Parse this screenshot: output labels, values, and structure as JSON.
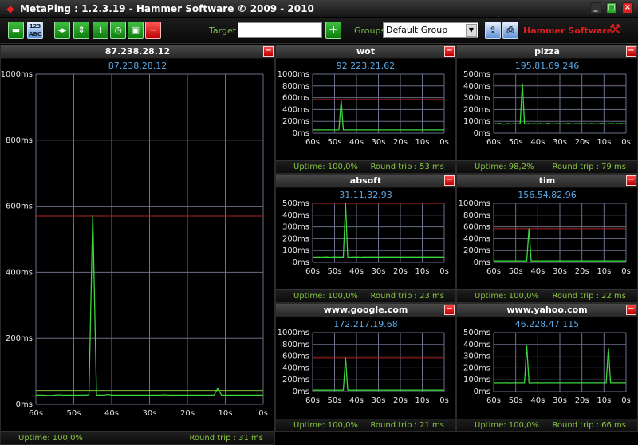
{
  "window": {
    "title": "MetaPing : 1.2.3.19 - Hammer Software © 2009 - 2010",
    "controls": [
      "_",
      "□",
      "×"
    ]
  },
  "toolbar": {
    "target_label": "Target",
    "target_value": "",
    "add_label": "+",
    "groups_label": "Groups",
    "group_value": "Default Group",
    "brand": "Hammer Software"
  },
  "colors": {
    "ping_line": "#3dd63d",
    "threshold_line": "#b32222",
    "grid": "#6a6f8a",
    "ip_text": "#5aa8e6",
    "footer_text": "#86c43e"
  },
  "panels": [
    {
      "name": "87.238.28.12",
      "ip": "87.238.28.12",
      "uptime": "Uptime: 100,0%",
      "round_trip": "Round trip : 31 ms",
      "chart_data": {
        "type": "line",
        "y_ticks": [
          "0ms",
          "200ms",
          "400ms",
          "600ms",
          "800ms",
          "1000ms"
        ],
        "ylim": [
          0,
          1000
        ],
        "x_ticks": [
          "60s",
          "50s",
          "40s",
          "30s",
          "20s",
          "10s",
          "0s"
        ],
        "threshold": 570,
        "secondary_threshold": 42,
        "values": [
          28,
          28,
          28,
          27,
          27,
          28,
          29,
          28,
          28,
          28,
          28,
          28,
          28,
          28,
          29,
          575,
          28,
          28,
          28,
          30,
          28,
          28,
          28,
          28,
          28,
          28,
          28,
          28,
          28,
          28,
          28,
          28,
          28,
          28,
          29,
          28,
          28,
          28,
          28,
          28,
          28,
          28,
          28,
          28,
          28,
          28,
          28,
          28,
          48,
          28,
          28,
          28,
          28,
          28,
          28,
          28,
          28,
          28,
          28,
          28,
          28
        ]
      }
    },
    {
      "name": "wot",
      "ip": "92.223.21.62",
      "uptime": "Uptime: 100,0%",
      "round_trip": "Round trip : 53 ms",
      "chart_data": {
        "type": "line",
        "y_ticks": [
          "0ms",
          "200ms",
          "400ms",
          "600ms",
          "800ms",
          "1000ms"
        ],
        "ylim": [
          0,
          1000
        ],
        "x_ticks": [
          "60s",
          "50s",
          "40s",
          "30s",
          "20s",
          "10s",
          "0s"
        ],
        "threshold": 570,
        "values": [
          55,
          55,
          55,
          54,
          55,
          55,
          55,
          55,
          55,
          55,
          55,
          55,
          55,
          560,
          55,
          55,
          55,
          55,
          55,
          55,
          55,
          55,
          55,
          55,
          55,
          55,
          55,
          55,
          55,
          55,
          55,
          55,
          55,
          55,
          55,
          55,
          55,
          55,
          55,
          55,
          55,
          55,
          55,
          55,
          55,
          55,
          55,
          55,
          55,
          55,
          55,
          55,
          55,
          55,
          55,
          55,
          55,
          55,
          55,
          55,
          55
        ]
      }
    },
    {
      "name": "pizza",
      "ip": "195.81.69.246",
      "uptime": "Uptime: 98,2%",
      "round_trip": "Round trip : 79 ms",
      "chart_data": {
        "type": "line",
        "y_ticks": [
          "0ms",
          "100ms",
          "200ms",
          "300ms",
          "400ms",
          "500ms"
        ],
        "ylim": [
          0,
          500
        ],
        "x_ticks": [
          "60s",
          "50s",
          "40s",
          "30s",
          "20s",
          "10s",
          "0s"
        ],
        "threshold": 410,
        "values": [
          78,
          80,
          79,
          82,
          78,
          77,
          80,
          79,
          78,
          80,
          78,
          79,
          81,
          420,
          78,
          79,
          82,
          78,
          80,
          79,
          78,
          81,
          79,
          78,
          80,
          82,
          79,
          78,
          80,
          79,
          81,
          78,
          79,
          80,
          82,
          79,
          78,
          80,
          79,
          81,
          78,
          80,
          79,
          78,
          81,
          80,
          79,
          78,
          80,
          82,
          79,
          78,
          80,
          79,
          81,
          78,
          80,
          79,
          82,
          78,
          80
        ]
      }
    },
    {
      "name": "absoft",
      "ip": "31.11.32.93",
      "uptime": "Uptime: 100,0%",
      "round_trip": "Round trip : 23 ms",
      "chart_data": {
        "type": "line",
        "y_ticks": [
          "0ms",
          "100ms",
          "200ms",
          "300ms",
          "400ms",
          "500ms"
        ],
        "ylim": [
          0,
          500
        ],
        "x_ticks": [
          "60s",
          "50s",
          "40s",
          "30s",
          "20s",
          "10s",
          "0s"
        ],
        "threshold": 500,
        "values": [
          45,
          44,
          45,
          45,
          44,
          45,
          46,
          45,
          44,
          45,
          45,
          45,
          45,
          45,
          45,
          500,
          45,
          44,
          45,
          45,
          46,
          45,
          44,
          45,
          45,
          45,
          45,
          45,
          45,
          45,
          45,
          45,
          45,
          45,
          45,
          45,
          45,
          45,
          45,
          45,
          45,
          45,
          45,
          45,
          45,
          45,
          45,
          45,
          45,
          45,
          45,
          45,
          45,
          45,
          45,
          45,
          45,
          45,
          45,
          45,
          45
        ]
      }
    },
    {
      "name": "tim",
      "ip": "156.54.82.96",
      "uptime": "Uptime: 100,0%",
      "round_trip": "Round trip : 22 ms",
      "chart_data": {
        "type": "line",
        "y_ticks": [
          "0ms",
          "200ms",
          "400ms",
          "600ms",
          "800ms",
          "1000ms"
        ],
        "ylim": [
          0,
          1000
        ],
        "x_ticks": [
          "60s",
          "50s",
          "40s",
          "30s",
          "20s",
          "10s",
          "0s"
        ],
        "threshold": 570,
        "values": [
          25,
          25,
          25,
          25,
          25,
          25,
          25,
          25,
          25,
          25,
          25,
          25,
          25,
          25,
          25,
          25,
          575,
          25,
          25,
          25,
          25,
          25,
          25,
          25,
          25,
          25,
          25,
          25,
          25,
          25,
          25,
          25,
          25,
          25,
          25,
          25,
          25,
          25,
          25,
          25,
          25,
          25,
          25,
          25,
          25,
          25,
          25,
          25,
          25,
          25,
          25,
          25,
          25,
          25,
          25,
          25,
          25,
          25,
          25,
          25,
          25
        ]
      }
    },
    {
      "name": "www.google.com",
      "ip": "172.217.19.68",
      "uptime": "Uptime: 100,0%",
      "round_trip": "Round trip : 21 ms",
      "chart_data": {
        "type": "line",
        "y_ticks": [
          "0ms",
          "200ms",
          "400ms",
          "600ms",
          "800ms",
          "1000ms"
        ],
        "ylim": [
          0,
          1000
        ],
        "x_ticks": [
          "60s",
          "50s",
          "40s",
          "30s",
          "20s",
          "10s",
          "0s"
        ],
        "threshold": 570,
        "values": [
          25,
          25,
          25,
          25,
          25,
          25,
          25,
          25,
          25,
          25,
          25,
          25,
          25,
          25,
          25,
          575,
          25,
          25,
          25,
          25,
          25,
          25,
          25,
          25,
          25,
          25,
          25,
          25,
          25,
          25,
          25,
          25,
          25,
          25,
          25,
          25,
          25,
          25,
          25,
          25,
          25,
          25,
          25,
          25,
          25,
          25,
          25,
          25,
          25,
          25,
          25,
          25,
          25,
          25,
          25,
          25,
          25,
          25,
          25,
          25,
          25
        ]
      }
    },
    {
      "name": "www.yahoo.com",
      "ip": "46.228.47.115",
      "uptime": "Uptime: 100,0%",
      "round_trip": "Round trip : 66 ms",
      "chart_data": {
        "type": "line",
        "y_ticks": [
          "0ms",
          "100ms",
          "200ms",
          "300ms",
          "400ms",
          "500ms"
        ],
        "ylim": [
          0,
          500
        ],
        "x_ticks": [
          "60s",
          "50s",
          "40s",
          "30s",
          "20s",
          "10s",
          "0s"
        ],
        "threshold": 395,
        "values": [
          75,
          74,
          75,
          75,
          74,
          75,
          76,
          75,
          74,
          75,
          75,
          75,
          75,
          75,
          75,
          390,
          75,
          74,
          75,
          75,
          76,
          75,
          74,
          75,
          75,
          75,
          75,
          75,
          75,
          75,
          75,
          75,
          75,
          75,
          75,
          75,
          75,
          75,
          75,
          75,
          75,
          75,
          75,
          75,
          75,
          75,
          75,
          75,
          75,
          75,
          75,
          75,
          370,
          75,
          75,
          75,
          75,
          75,
          75,
          75,
          75
        ]
      }
    }
  ]
}
